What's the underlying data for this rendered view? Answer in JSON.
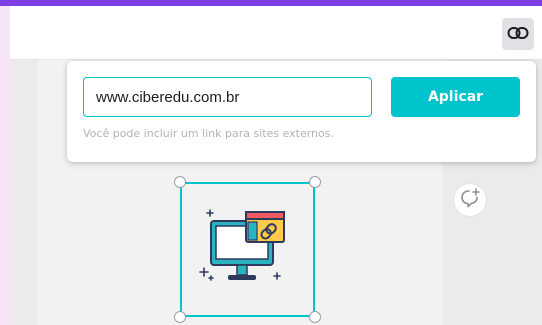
{
  "toolbar": {
    "link_button_icon": "link-icon"
  },
  "link_popover": {
    "url_value": "www.ciberedu.com.br",
    "apply_label": "Aplicar",
    "hint": "Você pode incluir um link para sites externos."
  },
  "canvas": {
    "selected_element_icon": "computer-link-illustration",
    "comment_icon": "add-comment-icon"
  },
  "colors": {
    "accent": "#00c4cc",
    "top_bar": "#7e40e6"
  }
}
